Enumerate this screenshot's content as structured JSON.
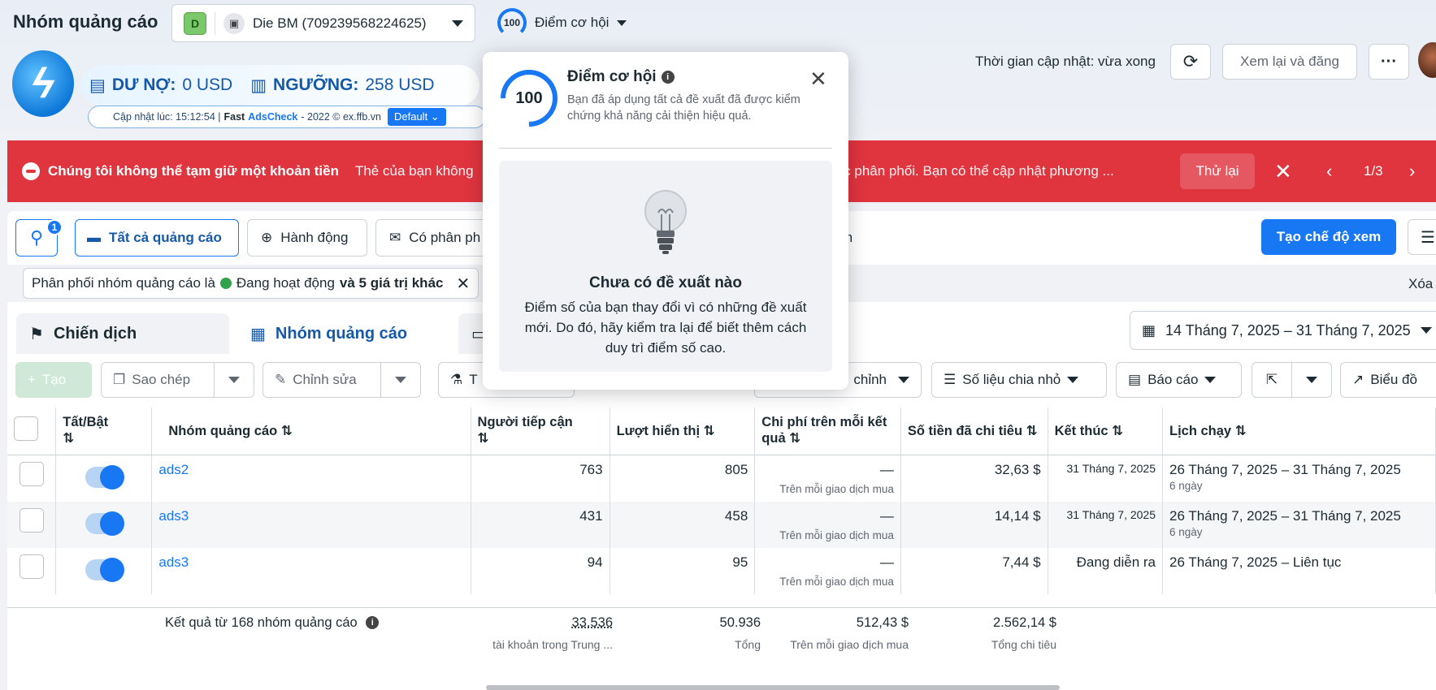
{
  "header": {
    "title": "Nhóm quảng cáo",
    "account_initial": "D",
    "account_name": "Die BM (709239568224625)",
    "opportunity_score": "100",
    "opportunity_label": "Điểm cơ hội",
    "update_time": "Thời gian cập nhật: vừa xong",
    "review_button": "Xem lại và đăng",
    "more_button": "···"
  },
  "extension": {
    "debt_label": "DƯ NỢ:",
    "debt_value": "0 USD",
    "threshold_label": "NGƯỠNG:",
    "threshold_value": "258 USD",
    "updated_text": "Cập nhật lúc: 15:12:54 |",
    "fast": "Fast",
    "adscheck": "AdsCheck",
    "copyright": "- 2022 © ex.ffb.vn",
    "mode": "Default"
  },
  "alert": {
    "title": "Chúng tôi không thể tạm giữ một khoản tiền",
    "message_start": "Thẻ của bạn không",
    "message_end": "ng được phân phối. Bạn có thể cập nhật phương ...",
    "retry": "Thử lại",
    "pager": "1/3"
  },
  "toolbar1": {
    "search_badge": "1",
    "all_ads": "Tất cả quảng cáo",
    "actions": "Hành động",
    "delivery": "Có phân ph",
    "fragment": "m",
    "create_view": "Tạo chế độ xem"
  },
  "filter": {
    "prefix": "Phân phối nhóm quảng cáo là",
    "status": "Đang hoạt động",
    "suffix": "và 5 giá trị khác",
    "clear": "Xóa"
  },
  "tabs": [
    {
      "label": "Chiến dịch"
    },
    {
      "label": "Nhóm quảng cáo"
    }
  ],
  "date_range": "14 Tháng 7, 2025 – 31 Tháng 7, 2025",
  "toolbar2": {
    "create": "Tạo",
    "copy": "Sao chép",
    "edit": "Chỉnh sửa",
    "test": "T",
    "custom": "chỉnh",
    "breakdown": "Số liệu chia nhỏ",
    "report": "Báo cáo",
    "chart": "Biểu đồ"
  },
  "table": {
    "headers": {
      "toggle": "Tất/Bật",
      "name": "Nhóm quảng cáo",
      "reach": "Người tiếp cận",
      "impressions": "Lượt hiển thị",
      "cpr": "Chi phí trên mỗi kết quả",
      "spent": "Số tiền đã chi tiêu",
      "end": "Kết thúc",
      "schedule": "Lịch chạy"
    },
    "rows": [
      {
        "name": "ads2",
        "reach": "763",
        "impressions": "805",
        "cpr": "—",
        "cpr_sub": "Trên mỗi giao dịch mua",
        "spent": "32,63 $",
        "end": "31 Tháng 7, 2025",
        "schedule": "26 Tháng 7, 2025 – 31 Tháng 7, 2025",
        "schedule_sub": "6 ngày"
      },
      {
        "name": "ads3",
        "reach": "431",
        "impressions": "458",
        "cpr": "—",
        "cpr_sub": "Trên mỗi giao dịch mua",
        "spent": "14,14 $",
        "end": "31 Tháng 7, 2025",
        "schedule": "26 Tháng 7, 2025 – 31 Tháng 7, 2025",
        "schedule_sub": "6 ngày"
      },
      {
        "name": "ads3",
        "reach": "94",
        "impressions": "95",
        "cpr": "—",
        "cpr_sub": "Trên mỗi giao dịch mua",
        "spent": "7,44 $",
        "end": "Đang diễn ra",
        "schedule": "26 Tháng 7, 2025 – Liên tục",
        "schedule_sub": ""
      }
    ],
    "footer": {
      "label": "Kết quả từ 168 nhóm quảng cáo",
      "reach": "33.536",
      "reach_sub": "tài khoản trong Trung ...",
      "impressions": "50.936",
      "impressions_sub": "Tổng",
      "cpr": "512,43 $",
      "cpr_sub": "Trên mỗi giao dịch mua",
      "spent": "2.562,14 $",
      "spent_sub": "Tổng chi tiêu"
    }
  },
  "popover": {
    "score": "100",
    "title": "Điểm cơ hội",
    "description": "Bạn đã áp dụng tất cả đề xuất đã được kiểm chứng khả năng cải thiện hiệu quả.",
    "empty_title": "Chưa có đề xuất nào",
    "empty_desc": "Điểm số của bạn thay đổi vì có những đề xuất mới. Do đó, hãy kiểm tra lại để biết thêm cách duy trì điểm số cao."
  },
  "colors": {
    "accent": "#1877f2",
    "alert": "#e0343f",
    "active": "#31a24c"
  }
}
